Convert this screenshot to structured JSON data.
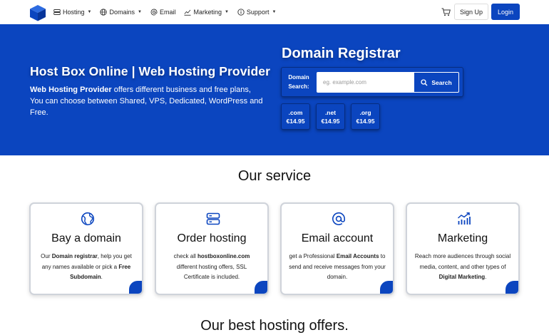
{
  "nav": {
    "items": [
      {
        "label": "Hosting",
        "icon": "server-icon",
        "caret": true
      },
      {
        "label": "Domains",
        "icon": "globe-icon",
        "caret": true
      },
      {
        "label": "Email",
        "icon": "at-icon",
        "caret": false
      },
      {
        "label": "Marketing",
        "icon": "chart-icon",
        "caret": true
      },
      {
        "label": "Support",
        "icon": "info-icon",
        "caret": true
      }
    ],
    "signup_label": "Sign Up",
    "login_label": "Login"
  },
  "hero": {
    "title": "Host Box Online | Web Hosting Provider",
    "desc_bold": "Web Hosting Provider",
    "desc_rest": " offers different business and free plans, You can choose between Shared, VPS, Dedicated, WordPress and Free."
  },
  "registrar": {
    "title": "Domain Registrar",
    "search_label_1": "Domain",
    "search_label_2": "Search:",
    "placeholder": "eg. example.com",
    "search_button": "Search",
    "tlds": [
      {
        "name": ".com",
        "price": "€14.95"
      },
      {
        "name": ".net",
        "price": "€14.95"
      },
      {
        "name": ".org",
        "price": "€14.95"
      }
    ]
  },
  "service": {
    "title": "Our service",
    "cards": [
      {
        "title": "Bay a domain",
        "icon": "globe-icon",
        "desc": [
          {
            "t": "Our "
          },
          {
            "t": "Domain registrar",
            "b": true
          },
          {
            "t": ", help you get any names available or pick a "
          },
          {
            "t": "Free Subdomain",
            "b": true
          },
          {
            "t": "."
          }
        ]
      },
      {
        "title": "Order hosting",
        "icon": "server-icon",
        "desc": [
          {
            "t": "check all "
          },
          {
            "t": "hostboxonline.com",
            "b": true
          },
          {
            "t": " different hosting offers, SSL Certificate is included."
          }
        ]
      },
      {
        "title": "Email account",
        "icon": "at-icon",
        "desc": [
          {
            "t": "get a Professional "
          },
          {
            "t": "Email Accounts",
            "b": true
          },
          {
            "t": " to send and receive messages from your domain."
          }
        ]
      },
      {
        "title": "Marketing",
        "icon": "chart-icon",
        "desc": [
          {
            "t": "Reach more audiences through social media, content, and other types of "
          },
          {
            "t": "Digital Marketing",
            "b": true
          },
          {
            "t": "."
          }
        ]
      }
    ]
  },
  "offers": {
    "title": "Our best hosting offers."
  },
  "colors": {
    "brand": "#0b45bf",
    "brand_dark": "#062c80"
  }
}
